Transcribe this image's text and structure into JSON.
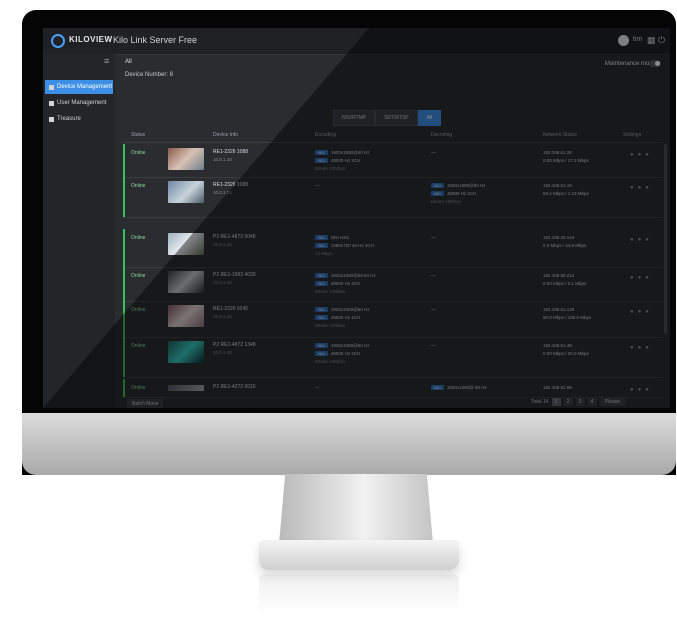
{
  "app": {
    "logo_text": "KILOVIEW",
    "title": "Kilo Link Server Free",
    "user": "tim",
    "colors": {
      "accent": "#3d8fe6",
      "online": "#38c25a",
      "chip": "#2f6fb5"
    }
  },
  "sidebar": {
    "items": [
      {
        "label": "Device Management",
        "icon": "monitor-icon"
      },
      {
        "label": "User Management",
        "icon": "user-icon"
      },
      {
        "label": "Treasure",
        "icon": "group-icon"
      }
    ]
  },
  "header": {
    "breadcrumb": "All",
    "device_count": "Device Number: 8",
    "maintenance_label": "Maintenance mode"
  },
  "filters": [
    "NDI/RTMP",
    "SRT/RTSP",
    "All"
  ],
  "table": {
    "columns": [
      "Status",
      "Device Info",
      "Encoding",
      "Decoding",
      "Network Status",
      "Settings"
    ],
    "rows": [
      {
        "status": "Online",
        "name": "RE1-2326 1088",
        "ip": "10.0.1.18",
        "enc": [
          "1920x1080@60 Hz",
          "48000 Hz 2CH",
          "Bitrate 12Mbps"
        ],
        "dec": [
          "—"
        ],
        "net": [
          "192.168.61.28",
          "0.00 Mbps / 17.3 Mbps"
        ]
      },
      {
        "status": "Online",
        "name": "RE1-2326 1088",
        "ip": "10.0.1.18",
        "enc": [
          "—"
        ],
        "dec": [
          "1920x1080@60 Hz",
          "48000 Hz 2CH",
          "Bitrate 16Mbps"
        ],
        "net": [
          "192.168.61.18",
          "69.4 Mbps / 1.23 Mbps"
        ]
      },
      {
        "status": "Online",
        "name": "P2 RE1-4872 0048",
        "ip": "10.0.1.18",
        "enc": [
          "NDI HX3",
          "1280x720 48 Hz 2CH",
          "12 Mbps"
        ],
        "dec": [
          "—"
        ],
        "net": [
          "192.168.20.144",
          "0.2 Mbps / 44.9 Mbps"
        ]
      },
      {
        "status": "Online",
        "name": "P2 RE1-1993 4039",
        "ip": "10.0.1.18",
        "enc": [
          "1920x1080@59.94 Hz",
          "48000 Hz 4CH",
          "Bitrate 12Mbps"
        ],
        "dec": [
          "—"
        ],
        "net": [
          "192.168.89.212",
          "0.00 Mbps / 0.1 Mbps"
        ]
      },
      {
        "status": "Online",
        "name": "RE1-2326 0245",
        "ip": "10.0.1.18",
        "enc": [
          "1920x1080@60 Hz",
          "48000 Hz 1CH",
          "Bitrate 12Mbps"
        ],
        "dec": [
          "—"
        ],
        "net": [
          "192.168.61.128",
          "50.0 Mbps / 195.0 Mbps"
        ]
      },
      {
        "status": "Online",
        "name": "P2 RE1-4872 1348",
        "ip": "10.0.1.18",
        "enc": [
          "1920x1080@60 Hz",
          "48000 Hz 2CH",
          "Bitrate 16Mbps"
        ],
        "dec": [
          "—"
        ],
        "net": [
          "192.168.61.48",
          "0.00 Mbps / 20.0 Mbps"
        ]
      },
      {
        "status": "Online",
        "name": "P2 RE1-4272 0016",
        "ip": "10.0.1.18",
        "enc": [
          "—"
        ],
        "dec": [
          "1920x1080@ 60 Hz"
        ],
        "net": [
          "192.168.61.69"
        ]
      }
    ]
  },
  "pager": {
    "left_button": "Batch Move",
    "total": "Total 14",
    "pages": [
      "1",
      "2",
      "3",
      "4"
    ],
    "per_page": "Please"
  }
}
